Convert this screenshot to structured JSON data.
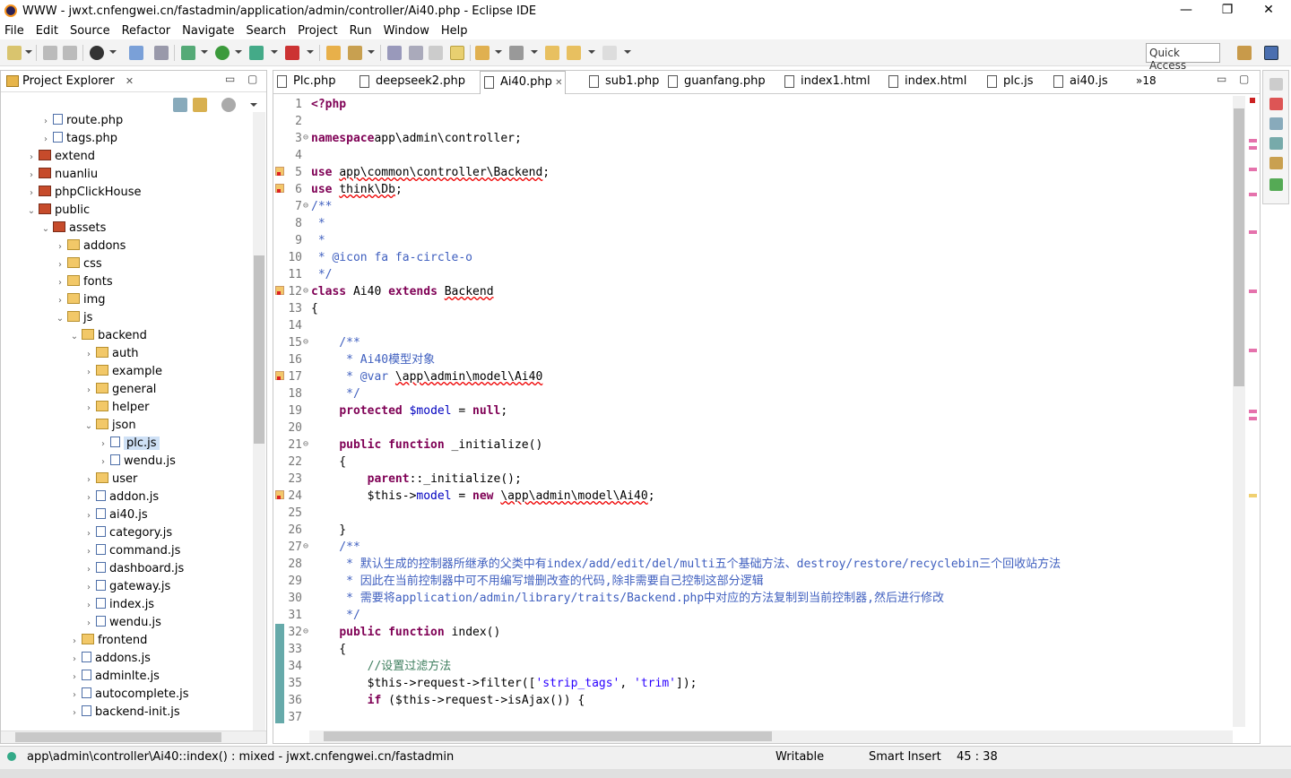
{
  "window": {
    "title": "WWW - jwxt.cnfengwei.cn/fastadmin/application/admin/controller/Ai40.php - Eclipse IDE",
    "minimize": "—",
    "maximize": "❐",
    "close": "✕"
  },
  "menu": [
    "File",
    "Edit",
    "Source",
    "Refactor",
    "Navigate",
    "Search",
    "Project",
    "Run",
    "Window",
    "Help"
  ],
  "quick_access": "Quick Access",
  "explorer": {
    "title": "Project Explorer",
    "close": "✕",
    "tree": [
      {
        "label": "route.php",
        "indent": 4,
        "tw": "›",
        "icon": "pfile"
      },
      {
        "label": "tags.php",
        "indent": 4,
        "tw": "›",
        "icon": "pfile"
      },
      {
        "label": "extend",
        "indent": 3,
        "tw": "›",
        "icon": "proj"
      },
      {
        "label": "nuanliu",
        "indent": 3,
        "tw": "›",
        "icon": "proj"
      },
      {
        "label": "phpClickHouse",
        "indent": 3,
        "tw": "›",
        "icon": "proj"
      },
      {
        "label": "public",
        "indent": 3,
        "tw": "⌄",
        "icon": "proj"
      },
      {
        "label": "assets",
        "indent": 4,
        "tw": "⌄",
        "icon": "proj"
      },
      {
        "label": "addons",
        "indent": 5,
        "tw": "›",
        "icon": "fold"
      },
      {
        "label": "css",
        "indent": 5,
        "tw": "›",
        "icon": "fold"
      },
      {
        "label": "fonts",
        "indent": 5,
        "tw": "›",
        "icon": "fold"
      },
      {
        "label": "img",
        "indent": 5,
        "tw": "›",
        "icon": "fold"
      },
      {
        "label": "js",
        "indent": 5,
        "tw": "⌄",
        "icon": "fold"
      },
      {
        "label": "backend",
        "indent": 6,
        "tw": "⌄",
        "icon": "fold"
      },
      {
        "label": "auth",
        "indent": 7,
        "tw": "›",
        "icon": "fold"
      },
      {
        "label": "example",
        "indent": 7,
        "tw": "›",
        "icon": "fold"
      },
      {
        "label": "general",
        "indent": 7,
        "tw": "›",
        "icon": "fold"
      },
      {
        "label": "helper",
        "indent": 7,
        "tw": "›",
        "icon": "fold"
      },
      {
        "label": "json",
        "indent": 7,
        "tw": "⌄",
        "icon": "fold"
      },
      {
        "label": "plc.js",
        "indent": 8,
        "tw": "›",
        "icon": "jfile",
        "selected": true
      },
      {
        "label": "wendu.js",
        "indent": 8,
        "tw": "›",
        "icon": "jfile"
      },
      {
        "label": "user",
        "indent": 7,
        "tw": "›",
        "icon": "fold"
      },
      {
        "label": "addon.js",
        "indent": 7,
        "tw": "›",
        "icon": "jfile"
      },
      {
        "label": "ai40.js",
        "indent": 7,
        "tw": "›",
        "icon": "jfile"
      },
      {
        "label": "category.js",
        "indent": 7,
        "tw": "›",
        "icon": "jfile"
      },
      {
        "label": "command.js",
        "indent": 7,
        "tw": "›",
        "icon": "jfile"
      },
      {
        "label": "dashboard.js",
        "indent": 7,
        "tw": "›",
        "icon": "jfile"
      },
      {
        "label": "gateway.js",
        "indent": 7,
        "tw": "›",
        "icon": "jfile"
      },
      {
        "label": "index.js",
        "indent": 7,
        "tw": "›",
        "icon": "jfile"
      },
      {
        "label": "wendu.js",
        "indent": 7,
        "tw": "›",
        "icon": "jfile"
      },
      {
        "label": "frontend",
        "indent": 6,
        "tw": "›",
        "icon": "fold"
      },
      {
        "label": "addons.js",
        "indent": 6,
        "tw": "›",
        "icon": "jfile"
      },
      {
        "label": "adminlte.js",
        "indent": 6,
        "tw": "›",
        "icon": "jfile"
      },
      {
        "label": "autocomplete.js",
        "indent": 6,
        "tw": "›",
        "icon": "jfile"
      },
      {
        "label": "backend-init.js",
        "indent": 6,
        "tw": "›",
        "icon": "jfile"
      }
    ]
  },
  "editor_tabs": [
    {
      "label": "Plc.php",
      "active": false
    },
    {
      "label": "deepseek2.php",
      "active": false
    },
    {
      "label": "Ai40.php",
      "active": true
    },
    {
      "label": "sub1.php",
      "active": false
    },
    {
      "label": "guanfang.php",
      "active": false
    },
    {
      "label": "index1.html",
      "active": false
    },
    {
      "label": "index.html",
      "active": false
    },
    {
      "label": "plc.js",
      "active": false
    },
    {
      "label": "ai40.js",
      "active": false
    }
  ],
  "more_tabs": "»18",
  "code": [
    {
      "n": "1",
      "parts": [
        [
          "kw",
          "<?php"
        ]
      ]
    },
    {
      "n": "2",
      "parts": []
    },
    {
      "n": "3",
      "fold": true,
      "parts": [
        [
          "kw",
          "namespace"
        ],
        [
          "",
          "app\\admin\\controller;"
        ]
      ]
    },
    {
      "n": "4",
      "parts": []
    },
    {
      "n": "5",
      "mark": true,
      "parts": [
        [
          "kw",
          "use"
        ],
        [
          "",
          " "
        ],
        [
          "err",
          "app\\common\\controller\\Backend"
        ],
        [
          "",
          ";"
        ]
      ]
    },
    {
      "n": "6",
      "mark": true,
      "parts": [
        [
          "kw",
          "use"
        ],
        [
          "",
          " "
        ],
        [
          "err",
          "think\\Db"
        ],
        [
          "",
          ";"
        ]
      ]
    },
    {
      "n": "7",
      "fold": true,
      "parts": [
        [
          "cm",
          "/**"
        ]
      ]
    },
    {
      "n": "8",
      "parts": [
        [
          "cm",
          " *"
        ]
      ]
    },
    {
      "n": "9",
      "parts": [
        [
          "cm",
          " *"
        ]
      ]
    },
    {
      "n": "10",
      "parts": [
        [
          "cm",
          " * @icon fa fa-circle-o"
        ]
      ]
    },
    {
      "n": "11",
      "parts": [
        [
          "cm",
          " */"
        ]
      ]
    },
    {
      "n": "12",
      "mark": true,
      "fold": true,
      "parts": [
        [
          "kw",
          "class"
        ],
        [
          "",
          " Ai40 "
        ],
        [
          "kw",
          "extends"
        ],
        [
          "",
          " "
        ],
        [
          "err",
          "Backend"
        ]
      ]
    },
    {
      "n": "13",
      "parts": [
        [
          "",
          "{"
        ]
      ]
    },
    {
      "n": "14",
      "parts": []
    },
    {
      "n": "15",
      "fold": true,
      "parts": [
        [
          "cm",
          "    /**"
        ]
      ]
    },
    {
      "n": "16",
      "parts": [
        [
          "cm",
          "     * Ai40模型对象"
        ]
      ]
    },
    {
      "n": "17",
      "mark": true,
      "parts": [
        [
          "cm",
          "     * @var "
        ],
        [
          "err",
          "\\app\\admin\\model\\Ai40"
        ]
      ]
    },
    {
      "n": "18",
      "parts": [
        [
          "cm",
          "     */"
        ]
      ]
    },
    {
      "n": "19",
      "parts": [
        [
          "",
          "    "
        ],
        [
          "kw",
          "protected"
        ],
        [
          "",
          " "
        ],
        [
          "var",
          "$model"
        ],
        [
          "",
          " = "
        ],
        [
          "kw",
          "null"
        ],
        [
          "",
          ";"
        ]
      ]
    },
    {
      "n": "20",
      "parts": []
    },
    {
      "n": "21",
      "fold": true,
      "parts": [
        [
          "",
          "    "
        ],
        [
          "kw",
          "public function"
        ],
        [
          "",
          " _initialize()"
        ]
      ]
    },
    {
      "n": "22",
      "parts": [
        [
          "",
          "    {"
        ]
      ]
    },
    {
      "n": "23",
      "parts": [
        [
          "",
          "        "
        ],
        [
          "kw",
          "parent"
        ],
        [
          "",
          "::_initialize();"
        ]
      ]
    },
    {
      "n": "24",
      "mark": true,
      "parts": [
        [
          "",
          "        $this->"
        ],
        [
          "var",
          "model"
        ],
        [
          "",
          " = "
        ],
        [
          "kw",
          "new"
        ],
        [
          "",
          " "
        ],
        [
          "err",
          "\\app\\admin\\model\\Ai40"
        ],
        [
          "",
          ";"
        ]
      ]
    },
    {
      "n": "25",
      "parts": []
    },
    {
      "n": "26",
      "parts": [
        [
          "",
          "    }"
        ]
      ]
    },
    {
      "n": "27",
      "fold": true,
      "parts": [
        [
          "cm",
          "    /**"
        ]
      ]
    },
    {
      "n": "28",
      "parts": [
        [
          "cm",
          "     * 默认生成的控制器所继承的父类中有index/add/edit/del/multi五个基础方法、destroy/restore/recyclebin三个回收站方法"
        ]
      ]
    },
    {
      "n": "29",
      "parts": [
        [
          "cm",
          "     * 因此在当前控制器中可不用编写增删改查的代码,除非需要自己控制这部分逻辑"
        ]
      ]
    },
    {
      "n": "30",
      "parts": [
        [
          "cm",
          "     * 需要将application/admin/library/traits/Backend.php中对应的方法复制到当前控制器,然后进行修改"
        ]
      ]
    },
    {
      "n": "31",
      "parts": [
        [
          "cm",
          "     */"
        ]
      ]
    },
    {
      "n": "32",
      "changed": true,
      "fold": true,
      "parts": [
        [
          "",
          "    "
        ],
        [
          "kw",
          "public function"
        ],
        [
          "",
          " index()"
        ]
      ]
    },
    {
      "n": "33",
      "changed": true,
      "parts": [
        [
          "",
          "    {"
        ]
      ]
    },
    {
      "n": "34",
      "changed": true,
      "parts": [
        [
          "lc",
          "        //设置过滤方法"
        ]
      ]
    },
    {
      "n": "35",
      "changed": true,
      "parts": [
        [
          "",
          "        $this->request->filter(["
        ],
        [
          "str",
          "'strip_tags'"
        ],
        [
          "",
          ", "
        ],
        [
          "str",
          "'trim'"
        ],
        [
          "",
          "]);"
        ]
      ]
    },
    {
      "n": "36",
      "changed": true,
      "parts": [
        [
          "",
          "        "
        ],
        [
          "kw",
          "if"
        ],
        [
          "",
          " ($this->request->isAjax()) {"
        ]
      ]
    },
    {
      "n": "37",
      "changed": true,
      "parts": []
    }
  ],
  "status": {
    "method": "app\\admin\\controller\\Ai40::index() : mixed - jwxt.cnfengwei.cn/fastadmin",
    "writable": "Writable",
    "insert": "Smart Insert",
    "position": "45 : 38"
  },
  "icons": [
    "eclipse-icon",
    "new-icon",
    "save-icon",
    "debug-icon",
    "run-icon",
    "search-icon",
    "project-explorer-icon",
    "outline-icon"
  ]
}
